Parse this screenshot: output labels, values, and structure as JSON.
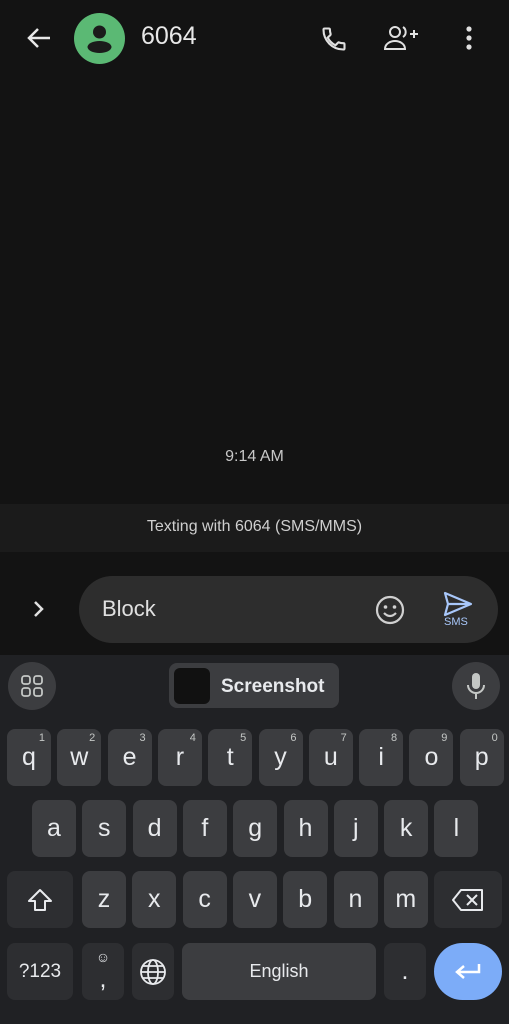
{
  "header": {
    "title": "6064",
    "icons": [
      "back-arrow-icon",
      "contact-avatar-icon",
      "phone-icon",
      "add-contact-icon",
      "more-vert-icon"
    ]
  },
  "conversation": {
    "timestamp": "9:14 AM",
    "banner": "Texting with 6064 (SMS/MMS)"
  },
  "composer": {
    "text": "Block",
    "send_label": "SMS"
  },
  "keyboard": {
    "suggestion": "Screenshot",
    "row1": [
      [
        "q",
        "1"
      ],
      [
        "w",
        "2"
      ],
      [
        "e",
        "3"
      ],
      [
        "r",
        "4"
      ],
      [
        "t",
        "5"
      ],
      [
        "y",
        "6"
      ],
      [
        "u",
        "7"
      ],
      [
        "i",
        "8"
      ],
      [
        "o",
        "9"
      ],
      [
        "p",
        "0"
      ]
    ],
    "row2": [
      "a",
      "s",
      "d",
      "f",
      "g",
      "h",
      "j",
      "k",
      "l"
    ],
    "row3": [
      "z",
      "x",
      "c",
      "v",
      "b",
      "n",
      "m"
    ],
    "symbols_label": "?123",
    "comma": ",",
    "space_label": "English",
    "period": "."
  },
  "colors": {
    "accent": "#7cacf8",
    "avatar": "#5bb974"
  }
}
